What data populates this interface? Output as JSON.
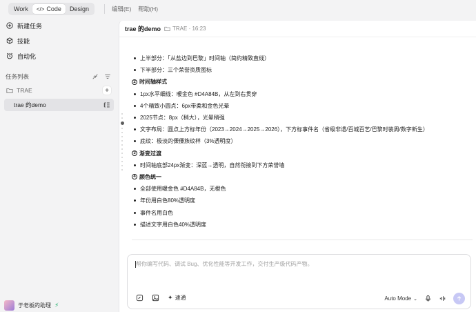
{
  "topbar": {
    "tabs": [
      {
        "label": "Work"
      },
      {
        "label": "Code"
      },
      {
        "label": "Design"
      }
    ],
    "menus": [
      "编辑(E)",
      "帮助(H)"
    ]
  },
  "sidebar": {
    "nav": [
      {
        "label": "新建任务",
        "icon": "plus-circle-icon"
      },
      {
        "label": "技能",
        "icon": "cube-icon"
      },
      {
        "label": "自动化",
        "icon": "alarm-clock-icon"
      }
    ],
    "section_title": "任务列表",
    "folder": "TRAE",
    "task": "trae 的demo",
    "user": "于老板的助理"
  },
  "main": {
    "title": "trae 的demo",
    "meta": "TRAE · 16:23",
    "lines": [
      {
        "type": "bullet",
        "text": "上半部分：「从盐边到巴黎」时间轴（简约精致直线）"
      },
      {
        "type": "bullet",
        "text": "下半部分：三个荣誉资质图标"
      },
      {
        "type": "head",
        "num": "2",
        "text": "时间轴样式"
      },
      {
        "type": "bullet",
        "text": "1px水平细线：暖金色 #D4A84B，从左到右贯穿"
      },
      {
        "type": "bullet",
        "text": "4个精致小圆点：6px带柔和金色光晕"
      },
      {
        "type": "bullet",
        "text": "2025节点：8px（稍大），光晕稍强"
      },
      {
        "type": "bullet",
        "text": "文字布局：圆点上方标年份（2023→2024→2025→2026），下方标事件名（省级非遗/百城百艺/巴黎时装周/数字新生）"
      },
      {
        "type": "bullet",
        "text": "底纹：极淡的傈僳族纹样（3%透明度）"
      },
      {
        "type": "head",
        "num": "3",
        "text": "渐变过渡"
      },
      {
        "type": "bullet",
        "text": "时间轴底部24px渐变：深蓝→透明，自然衔接到下方荣誉墙"
      },
      {
        "type": "head",
        "num": "4",
        "text": "颜色统一"
      },
      {
        "type": "bullet",
        "text": "全部使用暖金色 #D4A84B，无橙色"
      },
      {
        "type": "bullet",
        "text": "年份用白色80%透明度"
      },
      {
        "type": "bullet",
        "text": "事件名用白色"
      },
      {
        "type": "bullet",
        "text": "描述文字用白色40%透明度"
      }
    ]
  },
  "composer": {
    "placeholder": "帮你编写代码、调试 Bug、优化性能等开发工作，交付生产级代码产物。",
    "speed_label": "速通",
    "mode_label": "Auto Mode"
  },
  "colors": {
    "send_button": "#c7c8f5",
    "selected_task": "#e3e3e6",
    "sidebar_bg": "#f3f3f4"
  }
}
